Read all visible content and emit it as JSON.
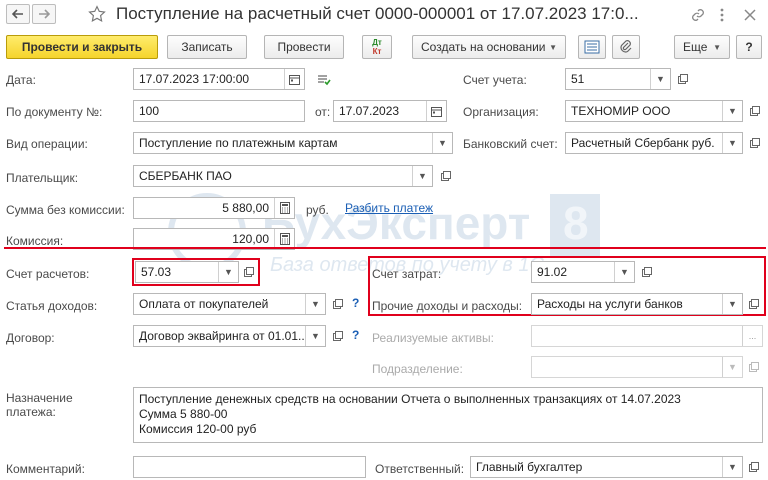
{
  "window": {
    "title": "Поступление на расчетный счет 0000-000001 от 17.07.2023 17:0..."
  },
  "toolbar": {
    "post_close": "Провести и закрыть",
    "save": "Записать",
    "post": "Провести",
    "dtkt_top": "Дт",
    "dtkt_bottom": "Кт",
    "create_based": "Создать на основании",
    "more": "Еще",
    "help": "?"
  },
  "form": {
    "date": {
      "label": "Дата:",
      "value": "17.07.2023 17:00:00"
    },
    "doc_no": {
      "label": "По документу №:",
      "value": "100",
      "from_label": "от:",
      "from_value": "17.07.2023"
    },
    "operation": {
      "label": "Вид операции:",
      "value": "Поступление по платежным картам"
    },
    "payer": {
      "label": "Плательщик:",
      "value": "СБЕРБАНК ПАО"
    },
    "amount_no_fee": {
      "label": "Сумма без комиссии:",
      "value": "5 880,00",
      "currency": "руб.",
      "split_link": "Разбить платеж"
    },
    "fee": {
      "label": "Комиссия:",
      "value": "120,00"
    },
    "settlement_account": {
      "label": "Счет расчетов:",
      "value": "57.03"
    },
    "income_item": {
      "label": "Статья доходов:",
      "value": "Оплата от покупателей"
    },
    "contract": {
      "label": "Договор:",
      "value": "Договор эквайринга от 01.01..."
    },
    "account": {
      "label": "Счет учета:",
      "value": "51"
    },
    "organization": {
      "label": "Организация:",
      "value": "ТЕХНОМИР ООО"
    },
    "bank_account": {
      "label": "Банковский счет:",
      "value": "Расчетный Сбербанк руб."
    },
    "cost_account": {
      "label": "Счет затрат:",
      "value": "91.02"
    },
    "other_income_expense": {
      "label": "Прочие доходы и расходы:",
      "value": "Расходы на услуги банков"
    },
    "sold_assets": {
      "label": "Реализуемые активы:",
      "value": ""
    },
    "department": {
      "label": "Подразделение:",
      "value": ""
    },
    "purpose": {
      "label_line1": "Назначение",
      "label_line2": "платежа:",
      "lines": [
        "Поступление денежных средств на основании Отчета о выполненных транзакциях от 14.07.2023",
        "Сумма 5 880-00",
        "Комиссия 120-00 руб"
      ]
    },
    "comment": {
      "label": "Комментарий:",
      "value": ""
    },
    "responsible": {
      "label": "Ответственный:",
      "value": "Главный бухгалтер"
    }
  },
  "watermark": {
    "brand": "БухЭксперт",
    "number": "8",
    "tagline": "База ответов по учету в 1С"
  },
  "colors": {
    "primary_button": "#f5d42c",
    "highlight": "#e0001c",
    "link": "#1b5fb5"
  }
}
